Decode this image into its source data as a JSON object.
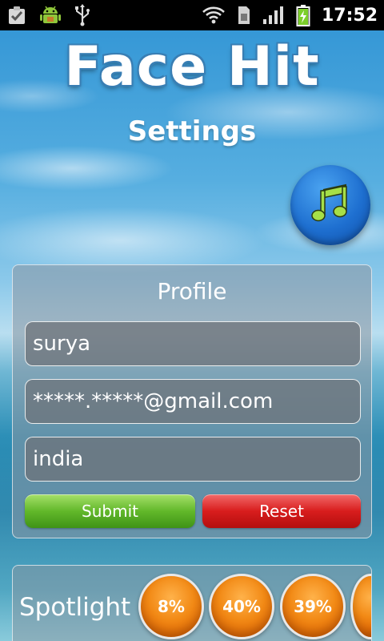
{
  "status_bar": {
    "time": "17:52",
    "left_icons": [
      "task-check-icon",
      "android-icon",
      "usb-icon"
    ],
    "right_icons": [
      "wifi-icon",
      "sim-card-icon",
      "signal-bars-icon",
      "battery-charging-icon"
    ]
  },
  "header": {
    "title": "Face Hit",
    "subtitle": "Settings"
  },
  "music_button": {
    "icon": "music-note-icon"
  },
  "profile": {
    "title": "Profile",
    "name_value": "surya",
    "email_value": "*****.*****@gmail.com",
    "country_value": "india",
    "submit_label": "Submit",
    "reset_label": "Reset"
  },
  "spotlight": {
    "label": "Spotlight",
    "items": [
      "8%",
      "40%",
      "39%"
    ]
  },
  "colors": {
    "submit": "#62b82a",
    "reset": "#d81d1d",
    "music_button": "#1e6fd0",
    "bubble": "#f28a16"
  }
}
